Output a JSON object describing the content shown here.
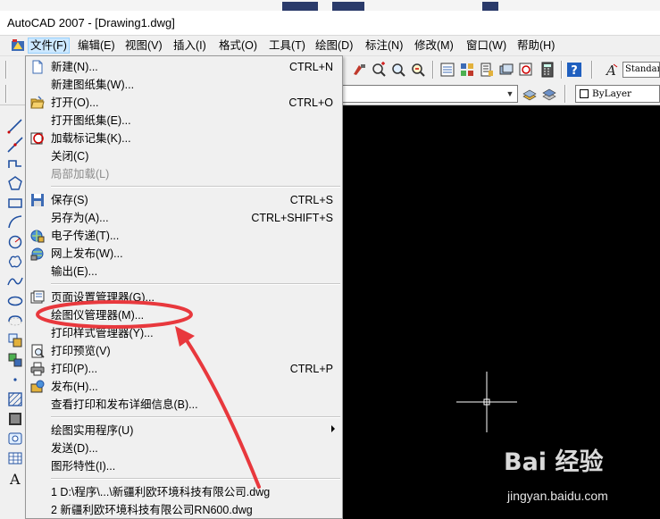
{
  "window": {
    "title": "AutoCAD 2007 - [Drawing1.dwg]"
  },
  "menubar": {
    "items": [
      {
        "label": "文件(F)",
        "active": true
      },
      {
        "label": "编辑(E)"
      },
      {
        "label": "视图(V)"
      },
      {
        "label": "插入(I)"
      },
      {
        "label": "格式(O)"
      },
      {
        "label": "工具(T)"
      },
      {
        "label": "绘图(D)"
      },
      {
        "label": "标注(N)"
      },
      {
        "label": "修改(M)"
      },
      {
        "label": "窗口(W)"
      },
      {
        "label": "帮助(H)"
      }
    ]
  },
  "toolbar": {
    "text_style": "Standar",
    "layer_value": "",
    "color_value": "ByLayer"
  },
  "file_menu": {
    "items": [
      {
        "label": "新建(N)...",
        "shortcut": "CTRL+N",
        "icon": "new-file-icon"
      },
      {
        "label": "新建图纸集(W)...",
        "shortcut": "",
        "icon": ""
      },
      {
        "label": "打开(O)...",
        "shortcut": "CTRL+O",
        "icon": "open-folder-icon"
      },
      {
        "label": "打开图纸集(E)...",
        "shortcut": "",
        "icon": ""
      },
      {
        "label": "加载标记集(K)...",
        "shortcut": "",
        "icon": "markup-icon"
      },
      {
        "label": "关闭(C)",
        "shortcut": "",
        "icon": ""
      },
      {
        "label": "局部加载(L)",
        "shortcut": "",
        "icon": "",
        "disabled": true
      },
      {
        "label": "保存(S)",
        "shortcut": "CTRL+S",
        "icon": "save-icon"
      },
      {
        "label": "另存为(A)...",
        "shortcut": "CTRL+SHIFT+S",
        "icon": ""
      },
      {
        "label": "电子传递(T)...",
        "shortcut": "",
        "icon": "etransmit-icon"
      },
      {
        "label": "网上发布(W)...",
        "shortcut": "",
        "icon": "publish-web-icon"
      },
      {
        "label": "输出(E)...",
        "shortcut": "",
        "icon": ""
      },
      {
        "label": "页面设置管理器(G)...",
        "shortcut": "",
        "icon": "page-setup-icon"
      },
      {
        "label": "绘图仪管理器(M)...",
        "shortcut": "",
        "icon": ""
      },
      {
        "label": "打印样式管理器(Y)...",
        "shortcut": "",
        "icon": ""
      },
      {
        "label": "打印预览(V)",
        "shortcut": "",
        "icon": "print-preview-icon"
      },
      {
        "label": "打印(P)...",
        "shortcut": "CTRL+P",
        "icon": "print-icon"
      },
      {
        "label": "发布(H)...",
        "shortcut": "",
        "icon": "publish-icon"
      },
      {
        "label": "查看打印和发布详细信息(B)...",
        "shortcut": "",
        "icon": ""
      },
      {
        "label": "绘图实用程序(U)",
        "shortcut": "",
        "icon": "",
        "submenu": true
      },
      {
        "label": "发送(D)...",
        "shortcut": "",
        "icon": ""
      },
      {
        "label": "图形特性(I)...",
        "shortcut": "",
        "icon": ""
      },
      {
        "label": "1 D:\\程序\\...\\新疆利欧环境科技有限公司.dwg",
        "shortcut": "",
        "icon": ""
      },
      {
        "label": "2 新疆利欧环境科技有限公司RN600.dwg",
        "shortcut": "",
        "icon": ""
      }
    ]
  },
  "annotation": {
    "highlighted_item": "绘图仪管理器(M)...",
    "color": "#e8383d"
  },
  "watermark": {
    "brand": "Bai 经验",
    "url": "jingyan.baidu.com"
  },
  "colors": {
    "menu_bg": "#f0f0f0",
    "canvas_bg": "#000000",
    "active_menu": "#cce8ff",
    "annotation_red": "#e8383d"
  }
}
